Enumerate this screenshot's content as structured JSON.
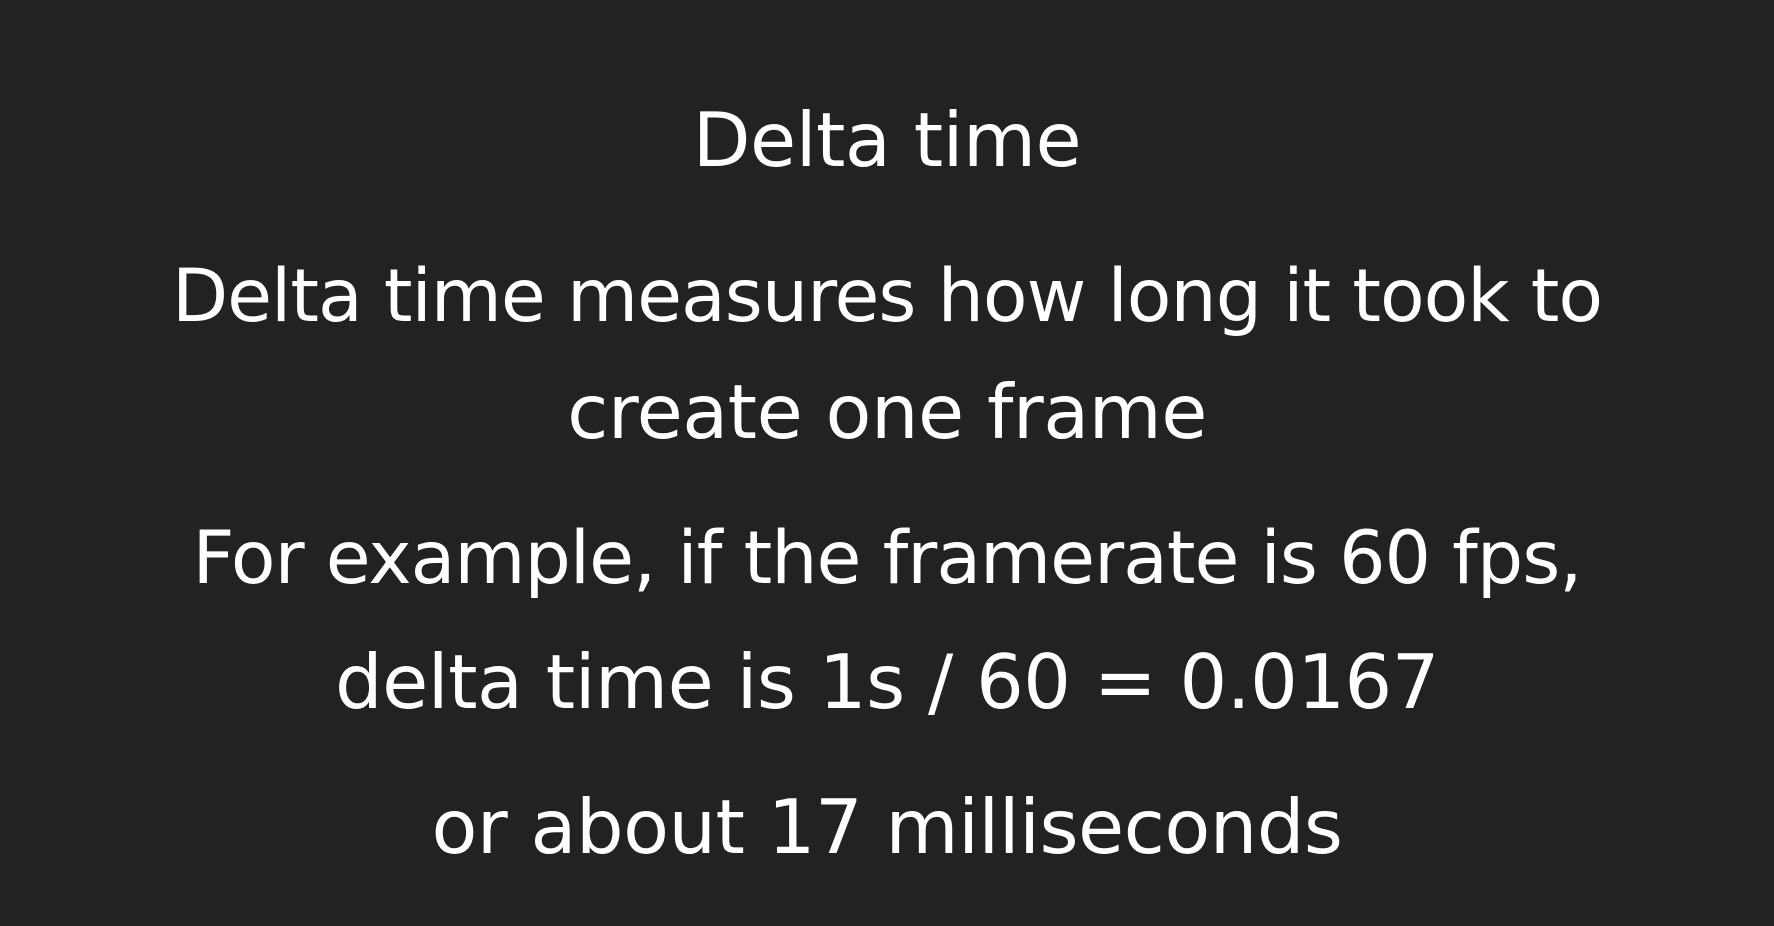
{
  "slide": {
    "title": "Delta time",
    "definition": [
      "Delta time measures how long it took to",
      "create one frame"
    ],
    "example": [
      "For example, if the framerate is 60 fps,",
      "delta time is 1s / 60 = 0.0167",
      "or about 17 milliseconds"
    ],
    "colors": {
      "background": "#222124",
      "text": "#ffffff"
    }
  }
}
